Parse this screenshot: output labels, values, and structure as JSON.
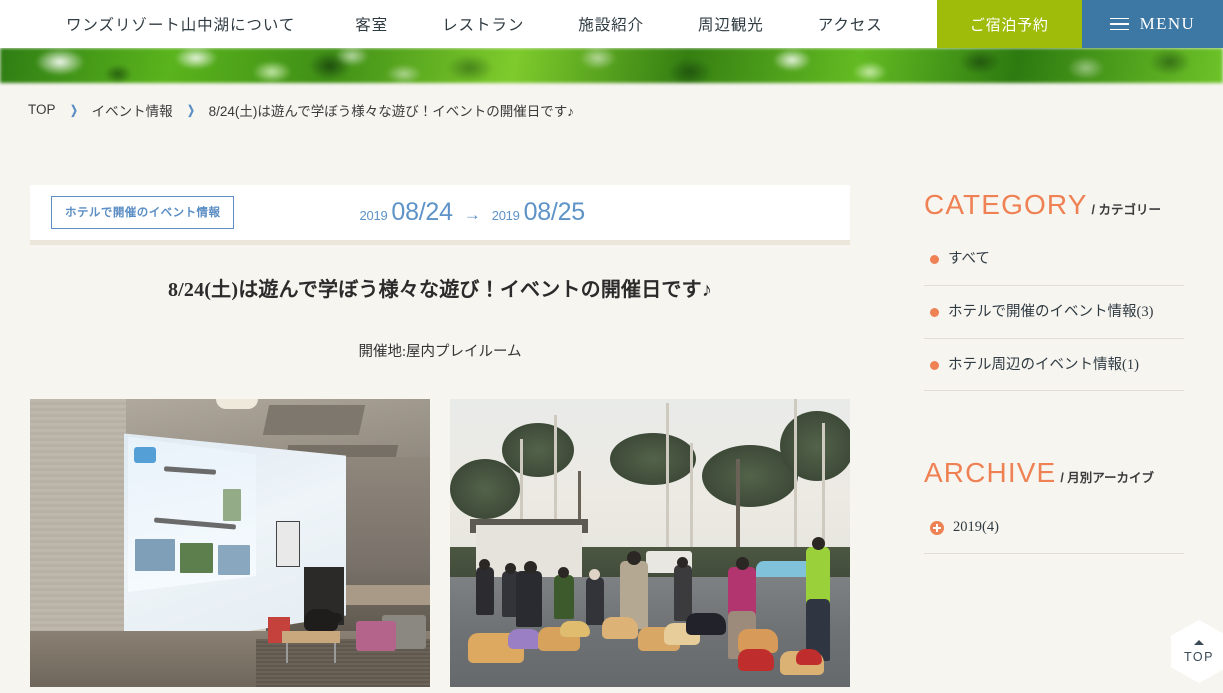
{
  "header": {
    "nav_links": [
      {
        "label": "ワンズリゾート山中湖について"
      },
      {
        "label": "客室"
      },
      {
        "label": "レストラン"
      },
      {
        "label": "施設紹介"
      },
      {
        "label": "周辺観光"
      },
      {
        "label": "アクセス"
      }
    ],
    "reserve_label": "ご宿泊予約",
    "menu_label": "MENU"
  },
  "breadcrumb": {
    "top": "TOP",
    "section": "イベント情報",
    "current": "8/24(土)は遊んで学ぼう様々な遊び！イベントの開催日です♪",
    "separator": "❯"
  },
  "article": {
    "category_badge": "ホテルで開催のイベント情報",
    "date_start_year": "2019",
    "date_start": "08/24",
    "date_arrow": "→",
    "date_end_year": "2019",
    "date_end": "08/25",
    "title": "8/24(土)は遊んで学ぼう様々な遊び！イベントの開催日です♪",
    "place": "開催地:屋内プレイルーム",
    "photos": [
      {
        "alt": "屋内プレイルームのセミナー風景（プロジェクター投影）"
      },
      {
        "alt": "屋外での犬とのトレーニング風景"
      }
    ]
  },
  "sidebar": {
    "category": {
      "title_en": "CATEGORY",
      "title_ja": "/ カテゴリー",
      "items": [
        {
          "label": "すべて"
        },
        {
          "label": "ホテルで開催のイベント情報(3)"
        },
        {
          "label": "ホテル周辺のイベント情報(1)"
        }
      ]
    },
    "archive": {
      "title_en": "ARCHIVE",
      "title_ja": "/ 月別アーカイブ",
      "items": [
        {
          "label": "2019(4)"
        }
      ]
    }
  },
  "top_button": {
    "label": "TOP",
    "caret": "▲"
  },
  "colors": {
    "page_background": "#f7f5f0",
    "nav_reserve_green": "#a0bc0a",
    "nav_menu_blue": "#3d77a3",
    "accent_orange": "#ef8254",
    "date_blue": "#5e93c8",
    "card_border_beige": "#ece6da"
  }
}
